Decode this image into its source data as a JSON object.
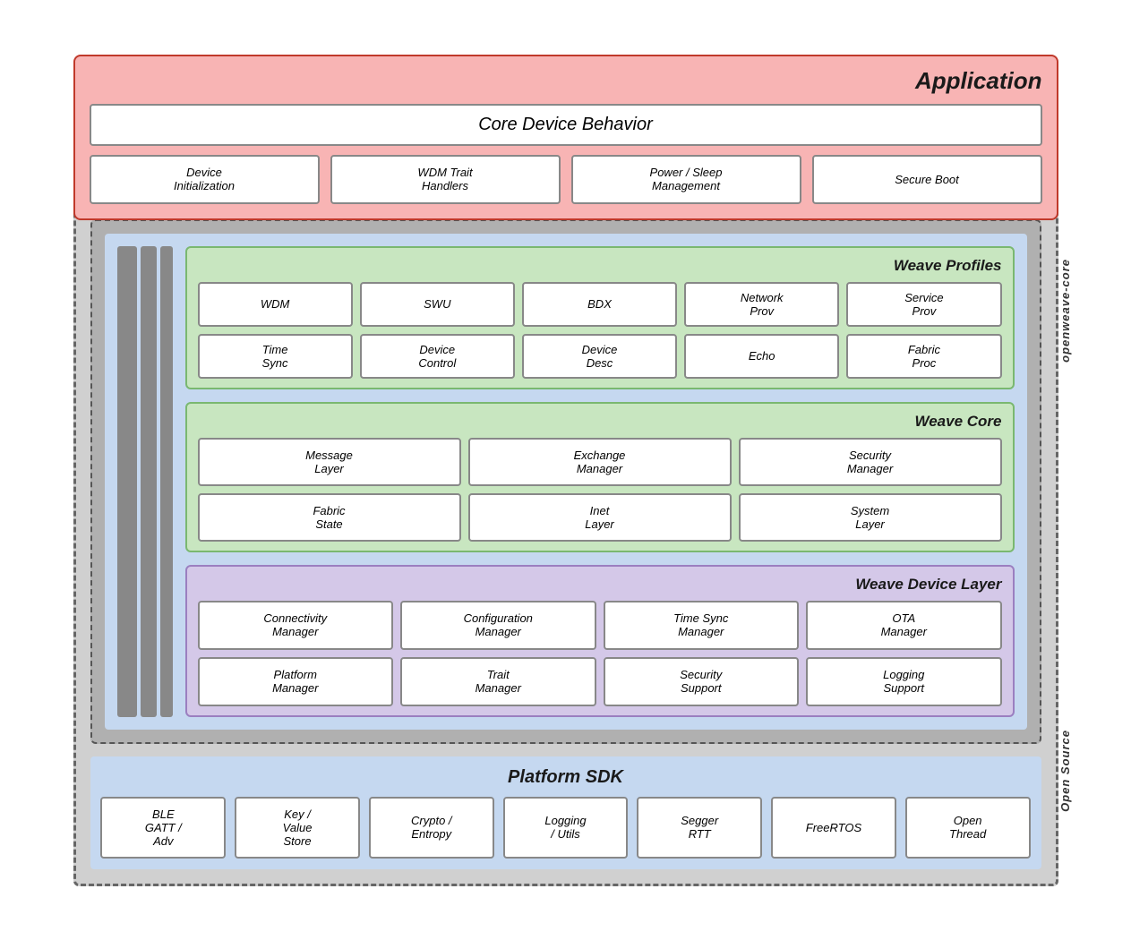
{
  "app": {
    "title": "Application",
    "core_device_behavior": "Core Device Behavior",
    "sub_boxes": [
      "Device\nInitialization",
      "WDM Trait\nHandlers",
      "Power / Sleep\nManagement",
      "Secure Boot"
    ]
  },
  "openweave_label": "openweave-core",
  "open_source_label": "Open Source",
  "weave_profiles": {
    "title": "Weave Profiles",
    "row1": [
      "WDM",
      "SWU",
      "BDX",
      "Network\nProv",
      "Service\nProv"
    ],
    "row2": [
      "Time\nSync",
      "Device\nControl",
      "Device\nDesc",
      "Echo",
      "Fabric\nProc"
    ]
  },
  "weave_core": {
    "title": "Weave Core",
    "row1": [
      "Message\nLayer",
      "Exchange\nManager",
      "Security\nManager"
    ],
    "row2": [
      "Fabric\nState",
      "Inet\nLayer",
      "System\nLayer"
    ]
  },
  "weave_device_layer": {
    "title": "Weave Device Layer",
    "row1": [
      "Connectivity\nManager",
      "Configuration\nManager",
      "Time Sync\nManager",
      "OTA\nManager"
    ],
    "row2": [
      "Platform\nManager",
      "Trait\nManager",
      "Security\nSupport",
      "Logging\nSupport"
    ]
  },
  "platform_sdk": {
    "title": "Platform SDK",
    "boxes": [
      "BLE\nGATT /\nAdv",
      "Key /\nValue\nStore",
      "Crypto /\nEntropy",
      "Logging\n/ Utils",
      "Segger\nRTT",
      "FreeRTOS",
      "Open\nThread"
    ]
  }
}
